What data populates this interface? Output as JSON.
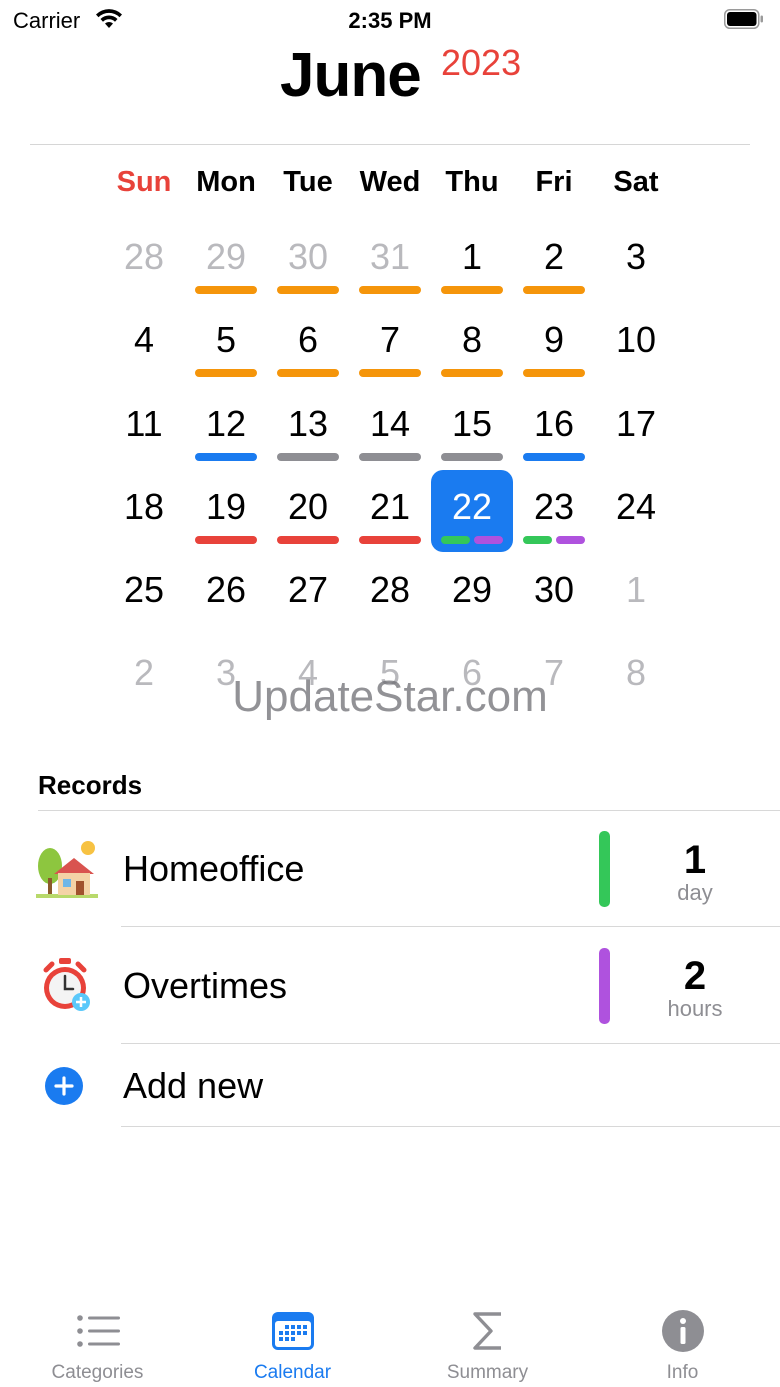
{
  "status": {
    "carrier": "Carrier",
    "time": "2:35 PM"
  },
  "header": {
    "month": "June",
    "year": "2023"
  },
  "weekdays": [
    "Sun",
    "Mon",
    "Tue",
    "Wed",
    "Thu",
    "Fri",
    "Sat"
  ],
  "calendar": {
    "selected_day": "22",
    "days": [
      {
        "d": "28",
        "muted": true
      },
      {
        "d": "29",
        "muted": true,
        "bars": [
          "#f5950a"
        ]
      },
      {
        "d": "30",
        "muted": true,
        "bars": [
          "#f5950a"
        ]
      },
      {
        "d": "31",
        "muted": true,
        "bars": [
          "#f5950a"
        ]
      },
      {
        "d": "1",
        "bars": [
          "#f5950a"
        ]
      },
      {
        "d": "2",
        "bars": [
          "#f5950a"
        ]
      },
      {
        "d": "3"
      },
      {
        "d": "4"
      },
      {
        "d": "5",
        "bars": [
          "#f5950a"
        ]
      },
      {
        "d": "6",
        "bars": [
          "#f5950a"
        ]
      },
      {
        "d": "7",
        "bars": [
          "#f5950a"
        ]
      },
      {
        "d": "8",
        "bars": [
          "#f5950a"
        ]
      },
      {
        "d": "9",
        "bars": [
          "#f5950a"
        ]
      },
      {
        "d": "10"
      },
      {
        "d": "11"
      },
      {
        "d": "12",
        "bars": [
          "#1a7bf0"
        ]
      },
      {
        "d": "13",
        "bars": [
          "#8e8e93"
        ]
      },
      {
        "d": "14",
        "bars": [
          "#8e8e93"
        ]
      },
      {
        "d": "15",
        "bars": [
          "#8e8e93"
        ]
      },
      {
        "d": "16",
        "bars": [
          "#1a7bf0"
        ]
      },
      {
        "d": "17"
      },
      {
        "d": "18"
      },
      {
        "d": "19",
        "bars": [
          "#e8423a"
        ]
      },
      {
        "d": "20",
        "bars": [
          "#e8423a"
        ]
      },
      {
        "d": "21",
        "bars": [
          "#e8423a"
        ]
      },
      {
        "d": "22",
        "selected": true,
        "bars": [
          "#34c759",
          "#af52de"
        ]
      },
      {
        "d": "23",
        "bars": [
          "#34c759",
          "#af52de"
        ]
      },
      {
        "d": "24"
      },
      {
        "d": "25"
      },
      {
        "d": "26"
      },
      {
        "d": "27"
      },
      {
        "d": "28"
      },
      {
        "d": "29"
      },
      {
        "d": "30"
      },
      {
        "d": "1",
        "muted": true
      },
      {
        "d": "2",
        "muted": true
      },
      {
        "d": "3",
        "muted": true
      },
      {
        "d": "4",
        "muted": true
      },
      {
        "d": "5",
        "muted": true
      },
      {
        "d": "6",
        "muted": true
      },
      {
        "d": "7",
        "muted": true
      },
      {
        "d": "8",
        "muted": true
      }
    ]
  },
  "watermark": "UpdateStar.com",
  "records": {
    "title": "Records",
    "items": [
      {
        "name": "Homeoffice",
        "value": "1",
        "unit": "day",
        "color": "#34c759",
        "icon": "house-icon"
      },
      {
        "name": "Overtimes",
        "value": "2",
        "unit": "hours",
        "color": "#af52de",
        "icon": "stopwatch-icon"
      }
    ],
    "add_label": "Add new"
  },
  "tabs": [
    {
      "label": "Categories",
      "icon": "list-icon",
      "active": false
    },
    {
      "label": "Calendar",
      "icon": "calendar-icon",
      "active": true
    },
    {
      "label": "Summary",
      "icon": "sigma-icon",
      "active": false
    },
    {
      "label": "Info",
      "icon": "info-icon",
      "active": false
    }
  ],
  "colors": {
    "accent": "#1a7bf0",
    "red": "#e8423a",
    "orange": "#f5950a",
    "gray": "#8e8e93",
    "green": "#34c759",
    "purple": "#af52de"
  }
}
